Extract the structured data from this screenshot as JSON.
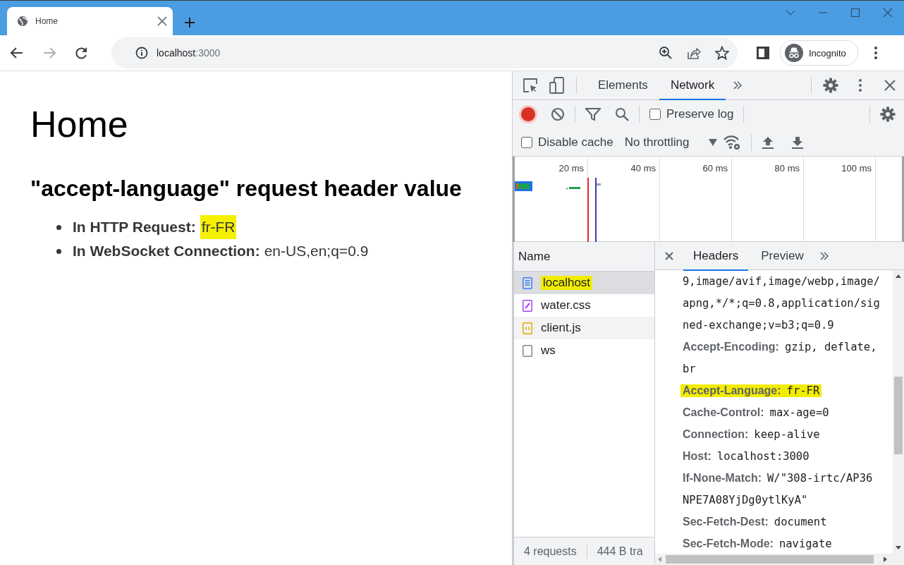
{
  "browser": {
    "tab_title": "Home",
    "forward_disabled": true,
    "address_host": "localhost",
    "address_port": ":3000",
    "profile": "Incognito"
  },
  "page": {
    "heading": "Home",
    "subheading": "\"accept-language\" request header value",
    "items": [
      {
        "label": "In HTTP Request:",
        "value": "fr-FR",
        "highlighted": true
      },
      {
        "label": "In WebSocket Connection:",
        "value": "en-US,en;q=0.9",
        "highlighted": false
      }
    ]
  },
  "devtools": {
    "tabs": [
      {
        "label": "Elements",
        "selected": false
      },
      {
        "label": "Network",
        "selected": true
      }
    ],
    "recording": true,
    "preserve_log": {
      "label": "Preserve log",
      "checked": false
    },
    "disable_cache": {
      "label": "Disable cache",
      "checked": false
    },
    "throttling": "No throttling",
    "overview_ticks": [
      "20 ms",
      "40 ms",
      "60 ms",
      "80 ms",
      "100 ms"
    ],
    "name_column": "Name",
    "requests": [
      {
        "name": "localhost",
        "kind": "document",
        "selected": true,
        "highlighted": true
      },
      {
        "name": "water.css",
        "kind": "stylesheet",
        "selected": false,
        "highlighted": false
      },
      {
        "name": "client.js",
        "kind": "script",
        "selected": false,
        "highlighted": false
      },
      {
        "name": "ws",
        "kind": "other",
        "selected": false,
        "highlighted": false
      }
    ],
    "detail_tabs": [
      {
        "label": "Headers",
        "selected": true
      },
      {
        "label": "Preview",
        "selected": false
      }
    ],
    "header_lines": [
      {
        "value": "9,image/avif,image/webp,image/",
        "highlighted": false
      },
      {
        "value": "apng,*/*;q=0.8,application/sig",
        "highlighted": false
      },
      {
        "value": "ned-exchange;v=b3;q=0.9",
        "highlighted": false
      },
      {
        "name": "Accept-Encoding:",
        "value": "gzip, deflate,",
        "highlighted": false
      },
      {
        "value": "br",
        "highlighted": false
      },
      {
        "name": "Accept-Language:",
        "value": "fr-FR",
        "highlighted": true
      },
      {
        "name": "Cache-Control:",
        "value": "max-age=0",
        "highlighted": false
      },
      {
        "name": "Connection:",
        "value": "keep-alive",
        "highlighted": false
      },
      {
        "name": "Host:",
        "value": "localhost:3000",
        "highlighted": false
      },
      {
        "name": "If-None-Match:",
        "value": "W/\"308-irtc/AP36",
        "highlighted": false
      },
      {
        "value": "NPE7A08YjDg0ytlKyA\"",
        "highlighted": false
      },
      {
        "name": "Sec-Fetch-Dest:",
        "value": "document",
        "highlighted": false
      },
      {
        "name": "Sec-Fetch-Mode:",
        "value": "navigate",
        "highlighted": false
      }
    ],
    "status": [
      "4 requests",
      "444 B tra"
    ]
  }
}
